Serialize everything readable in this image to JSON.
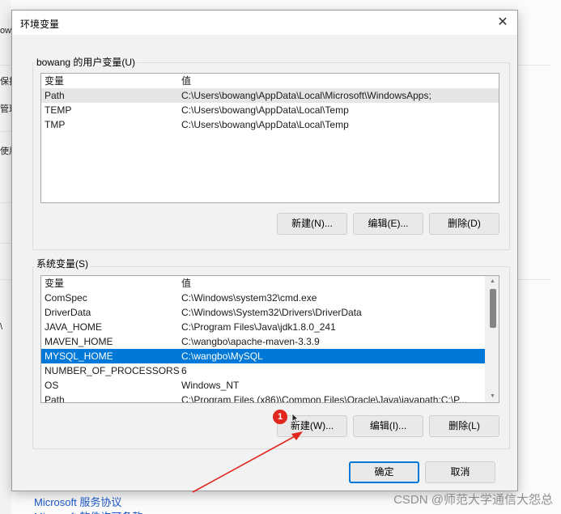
{
  "background": {
    "side_fragments": [
      "ow",
      "保护",
      "管理",
      "使用",
      "\\"
    ],
    "links": [
      "Microsoft 服务协议",
      "Microsoft 软件许可条款"
    ]
  },
  "dialog": {
    "title": "环境变量",
    "close_icon": "close-icon",
    "user_vars": {
      "label": "bowang 的用户变量(U)",
      "col_var": "变量",
      "col_val": "值",
      "rows": [
        {
          "var": "Path",
          "val": "C:\\Users\\bowang\\AppData\\Local\\Microsoft\\WindowsApps;"
        },
        {
          "var": "TEMP",
          "val": "C:\\Users\\bowang\\AppData\\Local\\Temp"
        },
        {
          "var": "TMP",
          "val": "C:\\Users\\bowang\\AppData\\Local\\Temp"
        }
      ],
      "buttons": {
        "new": "新建(N)...",
        "edit": "编辑(E)...",
        "delete": "删除(D)"
      }
    },
    "system_vars": {
      "label": "系统变量(S)",
      "col_var": "变量",
      "col_val": "值",
      "rows": [
        {
          "var": "ComSpec",
          "val": "C:\\Windows\\system32\\cmd.exe"
        },
        {
          "var": "DriverData",
          "val": "C:\\Windows\\System32\\Drivers\\DriverData"
        },
        {
          "var": "JAVA_HOME",
          "val": "C:\\Program Files\\Java\\jdk1.8.0_241"
        },
        {
          "var": "MAVEN_HOME",
          "val": "C:\\wangbo\\apache-maven-3.3.9"
        },
        {
          "var": "MYSQL_HOME",
          "val": "C:\\wangbo\\MySQL"
        },
        {
          "var": "NUMBER_OF_PROCESSORS",
          "val": "6"
        },
        {
          "var": "OS",
          "val": "Windows_NT"
        },
        {
          "var": "Path",
          "val": "C:\\Program Files (x86)\\Common Files\\Oracle\\Java\\javapath;C:\\P..."
        }
      ],
      "selected_var": "MYSQL_HOME",
      "buttons": {
        "new": "新建(W)...",
        "edit": "编辑(I)...",
        "delete": "删除(L)"
      }
    },
    "ok": "确定",
    "cancel": "取消"
  },
  "annotation": {
    "badge": "1",
    "color": "#e0261f"
  },
  "watermark": "CSDN @师范大学通信大怨总",
  "colors": {
    "selection": "#0078d7",
    "accent_border": "#0078d7"
  }
}
